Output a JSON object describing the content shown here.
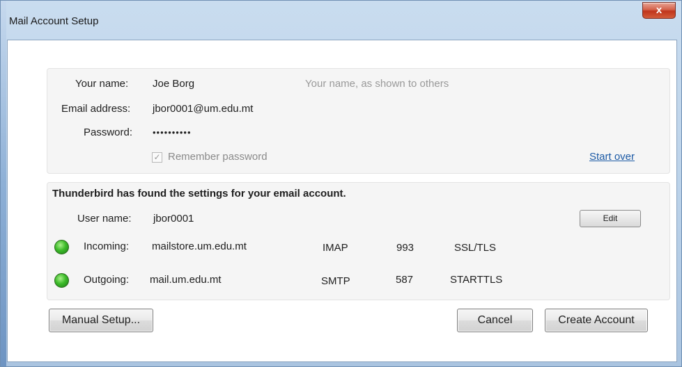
{
  "window": {
    "title": "Mail Account Setup",
    "close_glyph": "x"
  },
  "identity": {
    "name_label": "Your name:",
    "name_value": "Joe Borg",
    "name_hint": "Your name, as shown to others",
    "email_label": "Email address:",
    "email_value": "jbor0001@um.edu.mt",
    "password_label": "Password:",
    "password_value": "••••••••••",
    "remember_label": "Remember password",
    "remember_checked": true,
    "start_over_link": "Start over"
  },
  "settings": {
    "found_message": "Thunderbird has found the settings for your email account.",
    "username_label": "User name:",
    "username_value": "jbor0001",
    "edit_button": "Edit",
    "incoming": {
      "label": "Incoming:",
      "host": "mailstore.um.edu.mt",
      "protocol": "IMAP",
      "port": "993",
      "security": "SSL/TLS",
      "status_color": "#3dbb2a"
    },
    "outgoing": {
      "label": "Outgoing:",
      "host": "mail.um.edu.mt",
      "protocol": "SMTP",
      "port": "587",
      "security": "STARTTLS",
      "status_color": "#3dbb2a"
    }
  },
  "buttons": {
    "manual_setup": "Manual Setup...",
    "cancel": "Cancel",
    "create_account": "Create Account"
  },
  "icons": {
    "close": "close-icon",
    "status_ok": "green-status-icon",
    "checkbox": "checkmark-icon"
  }
}
